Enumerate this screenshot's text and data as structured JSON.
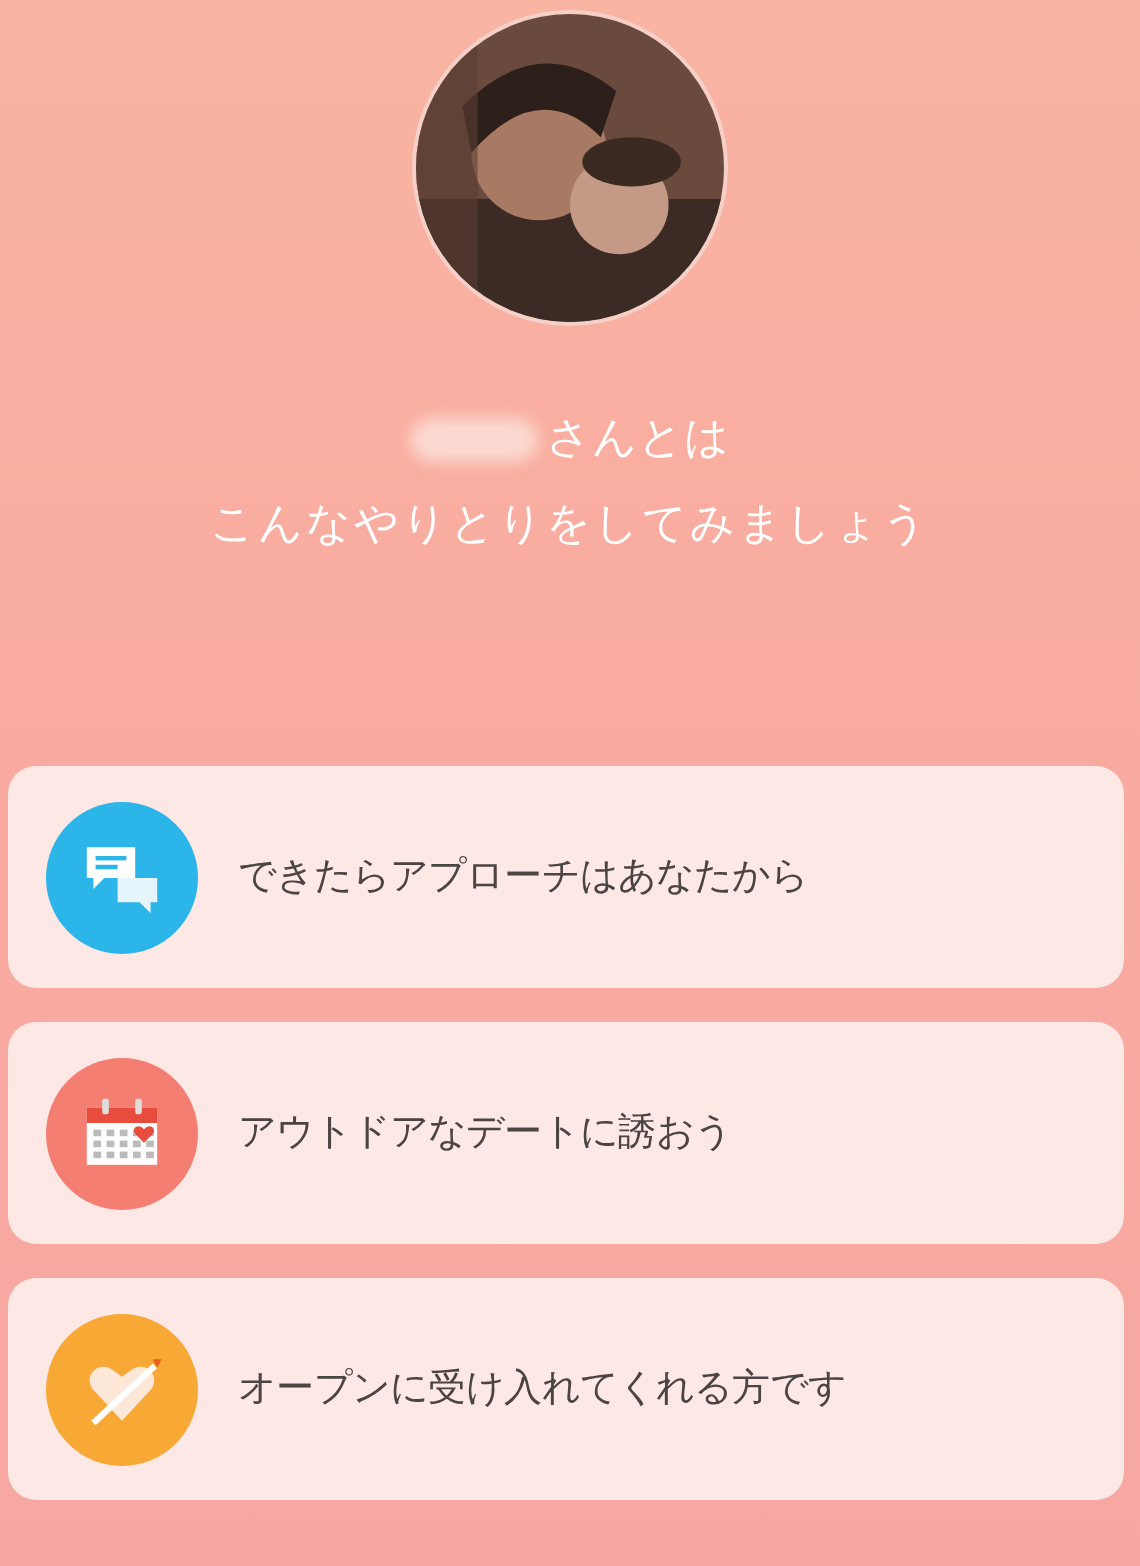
{
  "profile": {
    "name_suffix": "さんとは",
    "subtitle": "こんなやりとりをしてみましょう"
  },
  "suggestions": [
    {
      "kind": "chat",
      "color": "#2bb5e8",
      "text": "できたらアプローチはあなたから"
    },
    {
      "kind": "calendar",
      "color": "#f47e72",
      "text": "アウトドアなデートに誘おう"
    },
    {
      "kind": "heart",
      "color": "#f8a834",
      "text": "オープンに受け入れてくれる方です"
    }
  ]
}
